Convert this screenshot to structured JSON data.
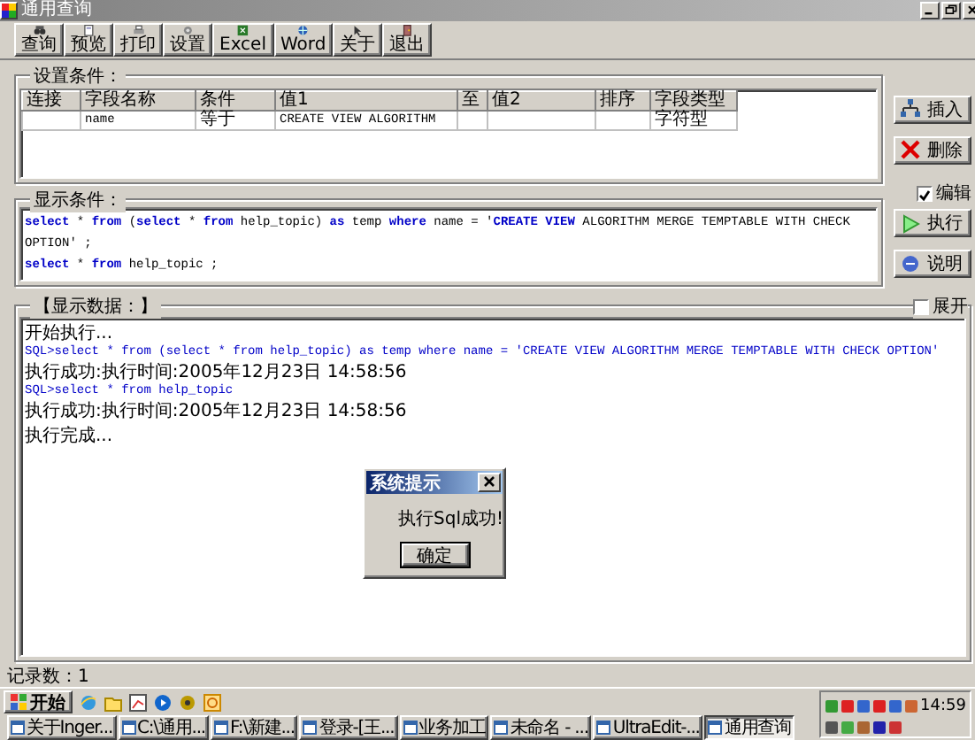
{
  "window": {
    "title": "通用查询"
  },
  "toolbar": [
    {
      "label": "查询",
      "kind": "query"
    },
    {
      "label": "预览",
      "kind": "preview"
    },
    {
      "label": "打印",
      "kind": "print"
    },
    {
      "label": "设置",
      "kind": "settings"
    },
    {
      "label": "Excel",
      "kind": "excel"
    },
    {
      "label": "Word",
      "kind": "word"
    },
    {
      "label": "关于",
      "kind": "about"
    },
    {
      "label": "退出",
      "kind": "exit"
    }
  ],
  "conditions": {
    "title": "设置条件：",
    "columns": [
      "连接",
      "字段名称",
      "条件",
      "值1",
      "至",
      "值2",
      "排序",
      "字段类型"
    ],
    "rows": [
      {
        "cells": [
          null,
          "name",
          "等于",
          "CREATE VIEW  ALGORITHM",
          null,
          null,
          null,
          "字符型"
        ]
      }
    ],
    "actions": [
      {
        "label": "插入",
        "kind": "insert"
      },
      {
        "label": "删除",
        "kind": "delete"
      }
    ]
  },
  "sql_panel": {
    "title": "显示条件：",
    "edit": {
      "label": "编辑",
      "checked": true
    },
    "lines": [
      [
        {
          "kind": "keyword",
          "text": "select"
        },
        {
          "kind": "plain",
          "text": " * "
        },
        {
          "kind": "keyword",
          "text": "from"
        },
        {
          "kind": "plain",
          "text": " ("
        },
        {
          "kind": "keyword",
          "text": "select"
        },
        {
          "kind": "plain",
          "text": " * "
        },
        {
          "kind": "keyword",
          "text": "from"
        },
        {
          "kind": "plain",
          "text": " help_topic) "
        },
        {
          "kind": "keyword",
          "text": "as"
        },
        {
          "kind": "plain",
          "text": " temp "
        },
        {
          "kind": "keyword",
          "text": "where"
        },
        {
          "kind": "plain",
          "text": " name = '"
        },
        {
          "kind": "keyword",
          "text": "CREATE VIEW"
        },
        {
          "kind": "plain",
          "text": "  ALGORITHM MERGE TEMPTABLE WITH CHECK OPTION' ;"
        }
      ],
      [
        {
          "kind": "keyword",
          "text": "select"
        },
        {
          "kind": "plain",
          "text": " * "
        },
        {
          "kind": "keyword",
          "text": "from"
        },
        {
          "kind": "plain",
          "text": " help_topic ;"
        }
      ]
    ],
    "actions": [
      {
        "label": "执行",
        "kind": "run"
      },
      {
        "label": "说明",
        "kind": "help"
      }
    ]
  },
  "output_panel": {
    "title": "【显示数据：】",
    "expand": {
      "label": "展开",
      "checked": false
    },
    "lines": [
      {
        "kind": "info",
        "text": "开始执行..."
      },
      {
        "kind": "sql",
        "text": "SQL>select * from (select * from help_topic) as temp where name = 'CREATE VIEW  ALGORITHM MERGE TEMPTABLE WITH CHECK OPTION'"
      },
      {
        "kind": "info",
        "text": "执行成功:执行时间:2005年12月23日 14:58:56"
      },
      {
        "kind": "sql",
        "text": "SQL>select * from help_topic"
      },
      {
        "kind": "info",
        "text": "执行成功:执行时间:2005年12月23日 14:58:56"
      },
      {
        "kind": "info",
        "text": "执行完成..."
      }
    ]
  },
  "dialog": {
    "title": "系统提示",
    "message": "执行Sql成功!",
    "button": "确定"
  },
  "status_bar": {
    "text": "记录数：1"
  },
  "taskbar": {
    "start": "开始",
    "tasks": [
      {
        "label": "关于Inger...",
        "selected": false
      },
      {
        "label": "C:\\通用...",
        "selected": false
      },
      {
        "label": "F:\\新建...",
        "selected": false
      },
      {
        "label": "登录-[王...",
        "selected": false
      },
      {
        "label": "业务加工",
        "selected": false
      },
      {
        "label": "未命名 - ...",
        "selected": false
      },
      {
        "label": "UltraEdit-...",
        "selected": false
      },
      {
        "label": "通用查询",
        "selected": true
      }
    ],
    "clock": "14:59"
  }
}
